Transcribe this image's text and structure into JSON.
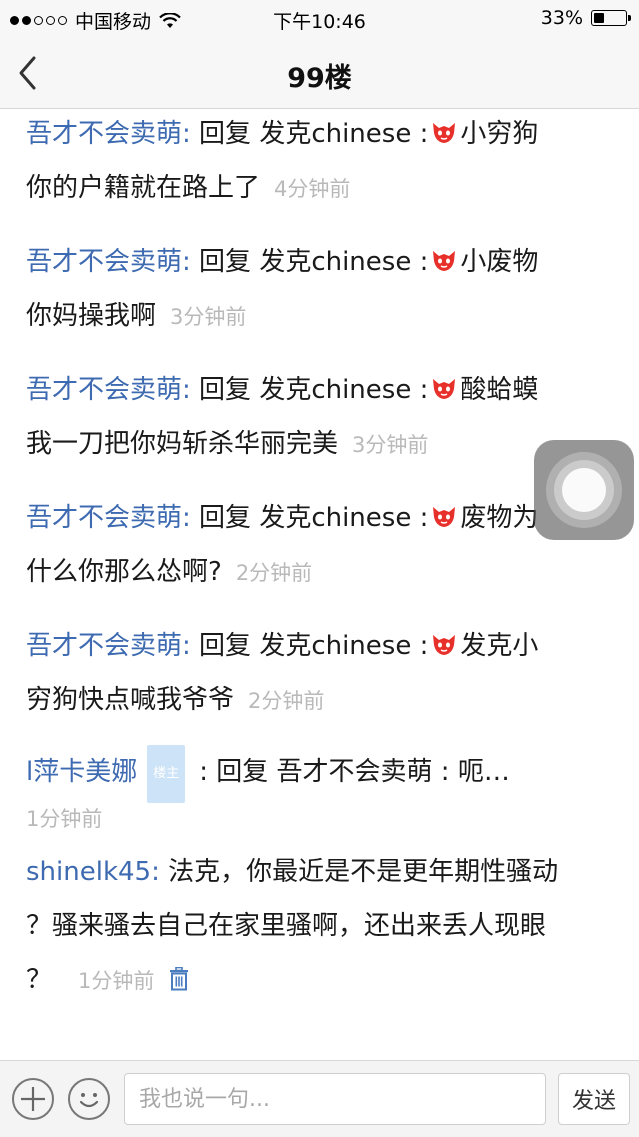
{
  "status_bar": {
    "carrier": "中国移动",
    "time": "下午10:46",
    "battery": "33%",
    "battery_level": 0.33
  },
  "nav": {
    "title": "99楼",
    "back_icon": "chevron-left-icon"
  },
  "replies": [
    {
      "user": "吾才不会卖萌:",
      "reply_word": "回复",
      "target": "发克chinese",
      "colon": ":",
      "emoji": "fox-sticker",
      "line1_rest": "小穷狗",
      "line2": "你的户籍就在路上了",
      "time": "4分钟前"
    },
    {
      "user": "吾才不会卖萌:",
      "reply_word": "回复",
      "target": "发克chinese",
      "colon": ":",
      "emoji": "fox-sticker",
      "line1_rest": "小废物",
      "line2": "你妈操我啊",
      "time": "3分钟前"
    },
    {
      "user": "吾才不会卖萌:",
      "reply_word": "回复",
      "target": "发克chinese",
      "colon": ":",
      "emoji": "fox-sticker",
      "line1_rest": "酸蛤蟆",
      "line2": "我一刀把你妈斩杀华丽完美",
      "time": "3分钟前"
    },
    {
      "user": "吾才不会卖萌:",
      "reply_word": "回复",
      "target": "发克chinese",
      "colon": ":",
      "emoji": "fox-sticker",
      "line1_rest": "废物为",
      "line2": "什么你那么怂啊?",
      "time": "2分钟前"
    },
    {
      "user": "吾才不会卖萌:",
      "reply_word": "回复",
      "target": "发克chinese",
      "colon": ":",
      "emoji": "fox-sticker",
      "line1_rest": "发克小",
      "line2": "穷狗快点喊我爷爷",
      "time": "2分钟前"
    }
  ],
  "owner_reply": {
    "user": "l萍卡美娜",
    "badge": "楼主",
    "text": ": 回复 吾才不会卖萌 : 呃…",
    "time": "1分钟前"
  },
  "last_reply": {
    "user": "shinelk45:",
    "line1": "法克，你最近是不是更年期性骚动",
    "line2": "？骚来骚去自己在家里骚啊，还出来丢人现眼",
    "line3": "？",
    "time": "1分钟前",
    "delete_icon": "trash-icon"
  },
  "input_bar": {
    "placeholder": "我也说一句...",
    "send_label": "发送"
  },
  "colors": {
    "username": "#3d6ab0",
    "timestamp": "#b9b9b9",
    "badge_bg": "#cde3f7",
    "fox": "#e8302a"
  }
}
